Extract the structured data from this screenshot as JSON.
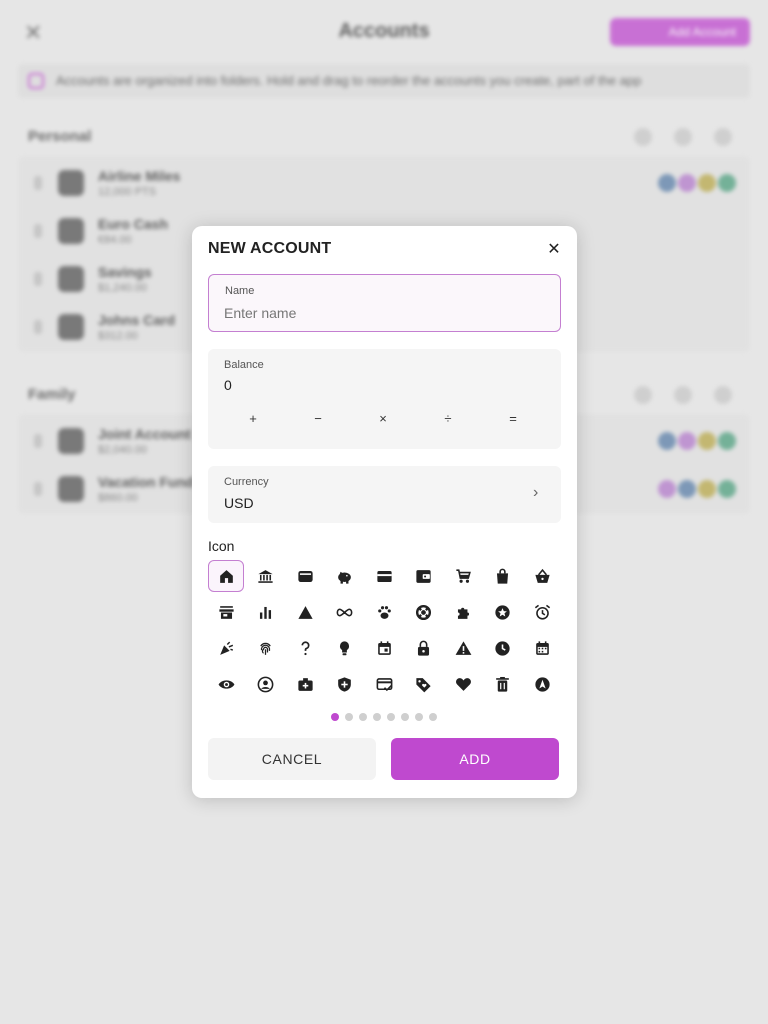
{
  "background": {
    "title": "Accounts",
    "action_label": "Add Account",
    "banner_text": "Accounts are organized into folders. Hold and drag to reorder the accounts you create, part of the app",
    "groups": [
      {
        "title": "Personal",
        "accounts": [
          {
            "name": "Airline Miles",
            "sub": "12,000 PTS"
          },
          {
            "name": "Euro Cash",
            "sub": "€84.00"
          },
          {
            "name": "Savings",
            "sub": "$1,240.00"
          },
          {
            "name": "Johns Card",
            "sub": "$312.00"
          }
        ]
      },
      {
        "title": "Family",
        "accounts": [
          {
            "name": "Joint Account",
            "sub": "$2,040.00"
          },
          {
            "name": "Vacation Fund",
            "sub": "$860.00"
          }
        ]
      }
    ]
  },
  "dialog": {
    "title": "NEW ACCOUNT",
    "name_field": {
      "label": "Name",
      "value": "",
      "placeholder": "Enter name"
    },
    "balance_field": {
      "label": "Balance",
      "value": "0",
      "operators": [
        "+",
        "−",
        "×",
        "÷",
        "="
      ]
    },
    "currency_field": {
      "label": "Currency",
      "value": "USD"
    },
    "icon_section_label": "Icon",
    "icons": [
      "home-icon",
      "bank-icon",
      "wallet-icon",
      "piggy-bank-icon",
      "credit-card-icon",
      "wallet-alt-icon",
      "cart-icon",
      "shopping-bag-icon",
      "basket-icon",
      "store-icon",
      "bar-chart-icon",
      "triangle-icon",
      "infinity-icon",
      "paw-icon",
      "lifebuoy-icon",
      "puzzle-icon",
      "star-badge-icon",
      "alarm-icon",
      "party-icon",
      "fingerprint-icon",
      "question-icon",
      "lightbulb-icon",
      "calendar-event-icon",
      "lock-icon",
      "warning-icon",
      "clock-icon",
      "calendar-icon",
      "eye-icon",
      "account-circle-icon",
      "medical-bag-icon",
      "shield-plus-icon",
      "card-check-icon",
      "tag-heart-icon",
      "heart-icon",
      "trash-icon",
      "navigation-icon"
    ],
    "selected_icon": 0,
    "pager": {
      "pages": 8,
      "active": 0
    },
    "cancel_label": "CANCEL",
    "add_label": "ADD"
  },
  "colors": {
    "accent": "#bf49cf",
    "focus_border": "#c47fd1",
    "field_bg": "#f5f5f5"
  }
}
